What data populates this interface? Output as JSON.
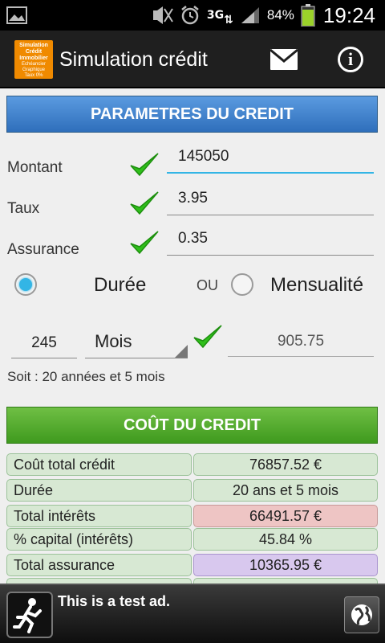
{
  "status_bar": {
    "image_icon": "image-notification-icon",
    "icons": [
      "mute-icon",
      "alarm-icon",
      "3g-data-icon",
      "signal-icon"
    ],
    "network": "3G",
    "battery_percent": "84%",
    "time": "19:24"
  },
  "action_bar": {
    "logo_lines": [
      "Simulation",
      "Crédit",
      "Immobilier"
    ],
    "logo_small_lines": [
      "Echéancier",
      "Graphique",
      "Taux 0%"
    ],
    "title": "Simulation crédit",
    "mail_icon": "mail-icon",
    "info_icon": "info-icon",
    "info_glyph": "i"
  },
  "params": {
    "header": "PARAMETRES DU CREDIT",
    "montant_label": "Montant",
    "montant_value": "145050",
    "taux_label": "Taux",
    "taux_value": "3.95",
    "assurance_label": "Assurance",
    "assurance_value": "0.35"
  },
  "mode": {
    "duree_label": "Durée",
    "ou_label": "OU",
    "mensualite_label": "Mensualité",
    "selected": "duree"
  },
  "duration": {
    "value": "245",
    "unit": "Mois",
    "mensualite_value": "905.75",
    "summary": "Soit : 20 années et 5 mois"
  },
  "cost": {
    "header": "COÛT DU CREDIT",
    "rows": [
      {
        "label": "Coût total crédit",
        "value": "76857.52 €"
      },
      {
        "label": "Durée",
        "value": "20 ans et 5 mois"
      },
      {
        "label": "Total intérêts",
        "value": "66491.57 €"
      },
      {
        "label": "% capital (intérêts)",
        "value": "45.84 %"
      },
      {
        "label": "Total assurance",
        "value": "10365.95 €"
      }
    ]
  },
  "ad": {
    "text": "This is a test ad.",
    "app_icon": "running-man-icon",
    "globe_icon": "globe-icon"
  },
  "colors": {
    "accent": "#33b5e5",
    "header_blue": "#3a7cc8",
    "header_green": "#4fa82a",
    "check_green": "#2fbf1a",
    "red_value": "#eec5c4",
    "purple_value": "#d8c8ee"
  }
}
